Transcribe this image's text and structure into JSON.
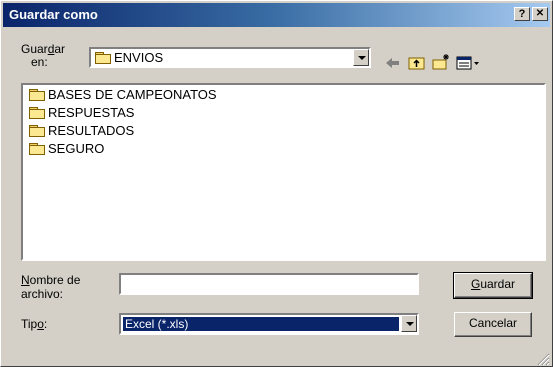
{
  "dialog": {
    "title": "Guardar como",
    "help_btn": "?",
    "close_btn": "✕"
  },
  "location": {
    "label_pre": "Guar",
    "label_accel": "d",
    "label_post": "ar",
    "label_line2": "en:",
    "value": "ENVIOS"
  },
  "toolbar": {
    "back_icon": "back-arrow-icon",
    "up_icon": "up-folder-icon",
    "new_folder_icon": "new-folder-icon",
    "view_icon": "view-menu-icon"
  },
  "files": [
    "BASES DE CAMPEONATOS",
    "RESPUESTAS",
    "RESULTADOS",
    "SEGURO"
  ],
  "filename": {
    "label_accel": "N",
    "label_rest": "ombre de",
    "label_line2": "archivo:",
    "value": ""
  },
  "filetype": {
    "label_pre": "Tip",
    "label_accel": "o",
    "label_post": ":",
    "value": "Excel (*.xls)"
  },
  "buttons": {
    "save_accel": "G",
    "save_rest": "uardar",
    "cancel": "Cancelar"
  },
  "colors": {
    "title_bar": "#0a246a",
    "selection": "#0a246a",
    "face": "#d4d0c8"
  }
}
